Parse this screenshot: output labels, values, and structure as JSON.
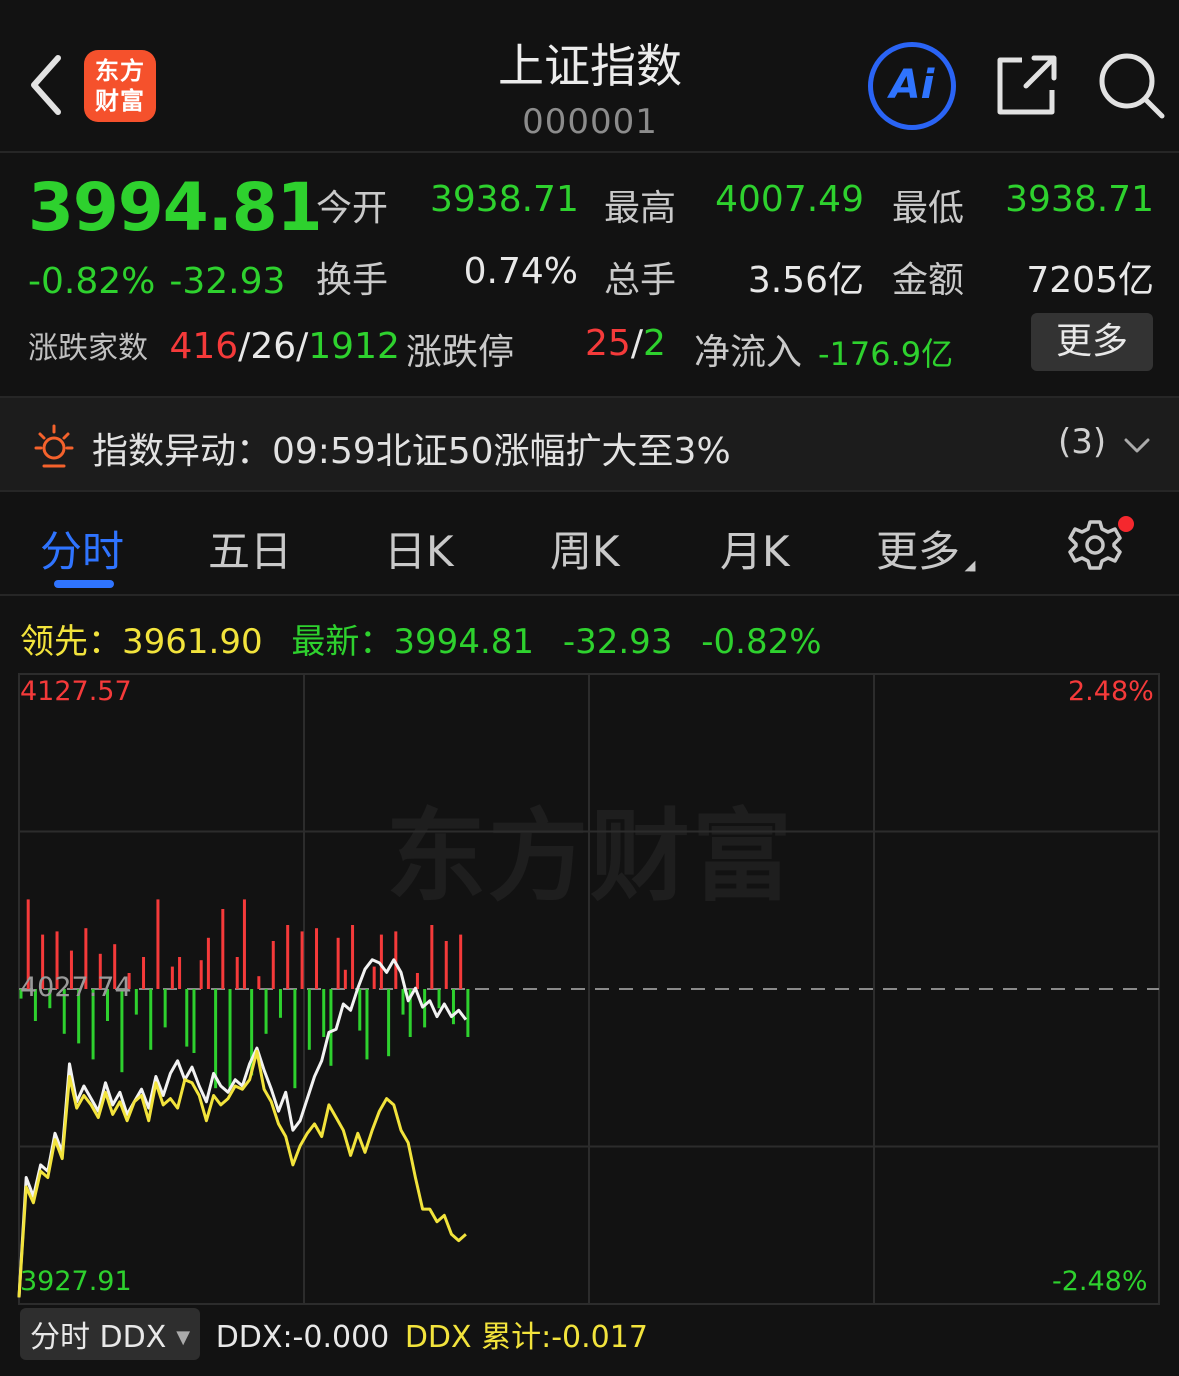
{
  "header": {
    "title": "上证指数",
    "code": "000001",
    "logo_line1": "东方",
    "logo_line2": "财富",
    "ai_label": "Ai"
  },
  "quote": {
    "price": "3994.81",
    "change_pct": "-0.82%",
    "change_abs": "-32.93",
    "open_label": "今开",
    "open": "3938.71",
    "high_label": "最高",
    "high": "4007.49",
    "low_label": "最低",
    "low": "3938.71",
    "turnover_label": "换手",
    "turnover": "0.74%",
    "volume_label": "总手",
    "volume": "3.56亿",
    "amount_label": "金额",
    "amount": "7205亿",
    "breadth_label": "涨跌家数",
    "up": "416",
    "flat": "26",
    "down": "1912",
    "limit_label": "涨跌停",
    "limit_up": "25",
    "limit_down": "2",
    "netflow_label": "净流入",
    "netflow": "-176.9亿",
    "more_label": "更多",
    "sep": "/"
  },
  "alert": {
    "text": "指数异动：09:59北证50涨幅扩大至3%",
    "count": "(3)"
  },
  "tabs": [
    {
      "label": "分时"
    },
    {
      "label": "五日"
    },
    {
      "label": "日K"
    },
    {
      "label": "周K"
    },
    {
      "label": "月K"
    },
    {
      "label": "更多"
    }
  ],
  "legend": {
    "lead_label": "领先：",
    "lead_value": "3961.90",
    "latest_label": "最新：",
    "latest_value": "3994.81",
    "latest_change": "-32.93",
    "latest_pct": "-0.82%"
  },
  "watermark": "东方财富",
  "colors": {
    "up": "#f53a3a",
    "down": "#2ed12e",
    "lead": "#f2e33c",
    "accent": "#2f74ff"
  },
  "chart_data": {
    "type": "line",
    "y_max": "4127.57",
    "y_mid": "4027.74",
    "y_min": "3927.91",
    "pct_max": "2.48%",
    "pct_min": "-2.48%",
    "ylim": [
      3927.91,
      4127.57
    ],
    "prev_close": 4027.74,
    "total_minutes": 240,
    "series": [
      {
        "values": [
          3930,
          3968,
          3962,
          3972,
          3970,
          3982,
          3976,
          4004,
          3992,
          3997,
          3993,
          3989,
          3998,
          3991,
          3995,
          3988,
          3992,
          3996,
          3990,
          4000,
          3994,
          4001,
          4005,
          3999,
          4003,
          3997,
          3992,
          4001,
          3997,
          3995,
          3999,
          3997,
          4004,
          4009,
          4002,
          3996,
          3989,
          3995,
          3983,
          3986,
          3993,
          4000,
          4005,
          4014,
          4015,
          4023,
          4021,
          4028,
          4034,
          4037,
          4036,
          4033,
          4037,
          4033,
          4024,
          4028,
          4022,
          4024,
          4019,
          4023,
          4019,
          4021,
          4018
        ]
      },
      {
        "values": [
          3930,
          3965,
          3960,
          3970,
          3968,
          3980,
          3974,
          4000,
          3990,
          3994,
          3991,
          3987,
          3995,
          3988,
          3992,
          3986,
          3992,
          3994,
          3986,
          3998,
          3991,
          3993,
          3990,
          3999,
          3998,
          3994,
          3986,
          3994,
          3991,
          3993,
          3997,
          3996,
          3999,
          4008,
          3996,
          3992,
          3985,
          3981,
          3972,
          3978,
          3982,
          3985,
          3981,
          3991,
          3987,
          3983,
          3975,
          3982,
          3976,
          3983,
          3989,
          3993,
          3991,
          3983,
          3979,
          3968,
          3958,
          3958,
          3954,
          3956,
          3950,
          3948,
          3950
        ]
      },
      {
        "name": "DDX",
        "values": [
          -3,
          28,
          -10,
          17,
          -6,
          18,
          -14,
          12,
          -17,
          19,
          -22,
          11,
          -10,
          14,
          -26,
          5,
          -8,
          10,
          -19,
          28,
          -12,
          7,
          10,
          -18,
          -20,
          9,
          16,
          -31,
          25,
          -31,
          10,
          28,
          -27,
          4,
          -14,
          15,
          -9,
          20,
          -31,
          18,
          -19,
          19,
          -15,
          -24,
          16,
          6,
          20,
          -13,
          -22,
          7,
          17,
          -21,
          18,
          -8,
          -15,
          5,
          -12,
          20,
          -6,
          15,
          -11,
          17,
          -15
        ]
      }
    ]
  },
  "ddx": {
    "select_label": "分时 DDX",
    "ddx_value": "DDX:-0.000",
    "ddx_cum": "DDX 累计:-0.017"
  }
}
